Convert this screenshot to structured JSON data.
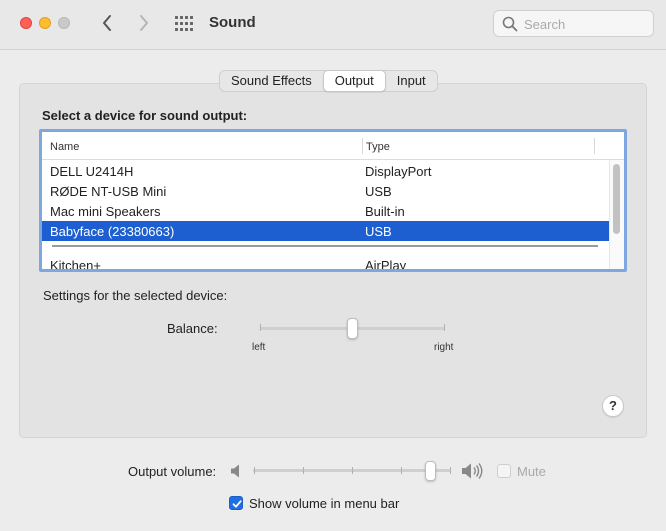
{
  "window": {
    "title": "Sound"
  },
  "search": {
    "placeholder": "Search"
  },
  "tabs": [
    {
      "label": "Sound Effects",
      "active": false
    },
    {
      "label": "Output",
      "active": true
    },
    {
      "label": "Input",
      "active": false
    }
  ],
  "output": {
    "section_title": "Select a device for sound output:",
    "columns": {
      "name": "Name",
      "type": "Type"
    },
    "devices": [
      {
        "name": "DELL U2414H",
        "type": "DisplayPort",
        "selected": false
      },
      {
        "name": "RØDE NT-USB Mini",
        "type": "USB",
        "selected": false
      },
      {
        "name": "Mac mini Speakers",
        "type": "Built-in",
        "selected": false
      },
      {
        "name": "Babyface (23380663)",
        "type": "USB",
        "selected": true
      },
      {
        "name": "Kitchen+",
        "type": "AirPlay",
        "selected": false
      }
    ],
    "settings_label": "Settings for the selected device:",
    "balance": {
      "label": "Balance:",
      "left_label": "left",
      "right_label": "right",
      "value": 0.5
    }
  },
  "help": {
    "label": "?"
  },
  "volume": {
    "label": "Output volume:",
    "value": 0.9,
    "mute_label": "Mute",
    "muted": false
  },
  "menu_bar": {
    "label": "Show volume in menu bar",
    "checked": true
  },
  "colors": {
    "selection": "#1d5fd0",
    "focus_ring": "#7ea6e0",
    "close": "#fe5f57",
    "minimize": "#febc2e",
    "checkbox": "#1f6ee6"
  },
  "icons": {
    "back": "chevron-left-icon",
    "forward": "chevron-right-icon",
    "grid": "grid-icon",
    "search": "search-icon",
    "volume_low": "speaker-low-icon",
    "volume_high": "speaker-high-icon"
  }
}
